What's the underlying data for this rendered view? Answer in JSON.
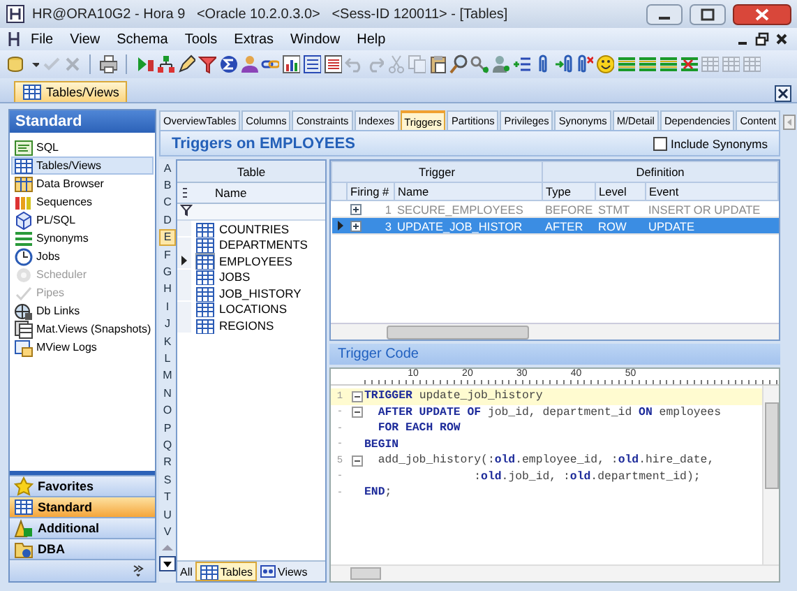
{
  "window": {
    "title": "HR@ORA10G2 - Hora 9   <Oracle 10.2.0.3.0>   <Sess-ID 120011> - [Tables]"
  },
  "menu": [
    "File",
    "View",
    "Schema",
    "Tools",
    "Extras",
    "Window",
    "Help"
  ],
  "toolbar": [
    {
      "kind": "db",
      "disabled": false
    },
    {
      "kind": "caret",
      "disabled": false
    },
    {
      "kind": "check",
      "disabled": true
    },
    {
      "kind": "cross",
      "disabled": true
    },
    {
      "kind": "separator"
    },
    {
      "kind": "printer",
      "disabled": false
    },
    {
      "kind": "separator"
    },
    {
      "kind": "play",
      "disabled": false
    },
    {
      "kind": "tree",
      "disabled": false
    },
    {
      "kind": "pen",
      "disabled": false
    },
    {
      "kind": "filter",
      "disabled": false
    },
    {
      "kind": "sigma",
      "disabled": false
    },
    {
      "kind": "person",
      "disabled": false
    },
    {
      "kind": "link",
      "disabled": false
    },
    {
      "kind": "chart",
      "disabled": false
    },
    {
      "kind": "form",
      "disabled": false
    },
    {
      "kind": "list",
      "disabled": false
    },
    {
      "kind": "undo",
      "disabled": true
    },
    {
      "kind": "redo",
      "disabled": true
    },
    {
      "kind": "cut",
      "disabled": true
    },
    {
      "kind": "copy",
      "disabled": true
    },
    {
      "kind": "paste",
      "disabled": false
    },
    {
      "kind": "search",
      "disabled": false
    },
    {
      "kind": "key",
      "disabled": false
    },
    {
      "kind": "findperson",
      "disabled": false
    },
    {
      "kind": "listadd",
      "disabled": false
    },
    {
      "kind": "clip",
      "disabled": false
    },
    {
      "kind": "clipin",
      "disabled": false
    },
    {
      "kind": "clipout",
      "disabled": false
    },
    {
      "kind": "smile",
      "disabled": false
    },
    {
      "kind": "bars",
      "disabled": false
    },
    {
      "kind": "bars",
      "disabled": false
    },
    {
      "kind": "bars",
      "disabled": false
    },
    {
      "kind": "barsx",
      "disabled": false
    },
    {
      "kind": "grid",
      "disabled": true
    },
    {
      "kind": "grid",
      "disabled": true
    },
    {
      "kind": "grid",
      "disabled": true
    }
  ],
  "document_tabs": [
    {
      "label": "Tables/Views",
      "selected": true
    }
  ],
  "navigator": {
    "title": "Standard",
    "items": [
      {
        "label": "SQL",
        "kind": "sql",
        "selected": false,
        "disabled": false
      },
      {
        "label": "Tables/Views",
        "kind": "table",
        "selected": true,
        "disabled": false
      },
      {
        "label": "Data Browser",
        "kind": "browser",
        "selected": false,
        "disabled": false
      },
      {
        "label": "Sequences",
        "kind": "sequence",
        "selected": false,
        "disabled": false
      },
      {
        "label": "PL/SQL",
        "kind": "plsql",
        "selected": false,
        "disabled": false
      },
      {
        "label": "Synonyms",
        "kind": "synonym",
        "selected": false,
        "disabled": false
      },
      {
        "label": "Jobs",
        "kind": "clock",
        "selected": false,
        "disabled": false
      },
      {
        "label": "Scheduler",
        "kind": "gear",
        "selected": false,
        "disabled": true
      },
      {
        "label": "Pipes",
        "kind": "pipe",
        "selected": false,
        "disabled": true
      },
      {
        "label": "Db Links",
        "kind": "link",
        "selected": false,
        "disabled": false
      },
      {
        "label": "Mat.Views (Snapshots)",
        "kind": "matview",
        "selected": false,
        "disabled": false
      },
      {
        "label": "MView Logs",
        "kind": "log",
        "selected": false,
        "disabled": false
      }
    ],
    "groups": [
      {
        "label": "Favorites",
        "kind": "star",
        "selected": false
      },
      {
        "label": "Standard",
        "kind": "table",
        "selected": true
      },
      {
        "label": "Additional",
        "kind": "shapes",
        "selected": false
      },
      {
        "label": "DBA",
        "kind": "dba",
        "selected": false
      }
    ]
  },
  "object_tabs": [
    {
      "label": "OverviewTables",
      "selected": false
    },
    {
      "label": "Columns",
      "selected": false
    },
    {
      "label": "Constraints",
      "selected": false
    },
    {
      "label": "Indexes",
      "selected": false
    },
    {
      "label": "Triggers",
      "selected": true
    },
    {
      "label": "Partitions",
      "selected": false
    },
    {
      "label": "Privileges",
      "selected": false
    },
    {
      "label": "Synonyms",
      "selected": false
    },
    {
      "label": "M/Detail",
      "selected": false
    },
    {
      "label": "Dependencies",
      "selected": false
    },
    {
      "label": "Content",
      "selected": false
    }
  ],
  "triggers_panel": {
    "title": "Triggers on EMPLOYEES",
    "include_synonyms": {
      "label": "Include Synonyms",
      "checked": false
    }
  },
  "index_letters": [
    {
      "label": "A",
      "selected": false
    },
    {
      "label": "B",
      "selected": false
    },
    {
      "label": "C",
      "selected": false
    },
    {
      "label": "D",
      "selected": false
    },
    {
      "label": "E",
      "selected": true
    },
    {
      "label": "F",
      "selected": false
    },
    {
      "label": "G",
      "selected": false
    },
    {
      "label": "H",
      "selected": false
    },
    {
      "label": "I",
      "selected": false
    },
    {
      "label": "J",
      "selected": false
    },
    {
      "label": "K",
      "selected": false
    },
    {
      "label": "L",
      "selected": false
    },
    {
      "label": "M",
      "selected": false
    },
    {
      "label": "N",
      "selected": false
    },
    {
      "label": "O",
      "selected": false
    },
    {
      "label": "P",
      "selected": false
    },
    {
      "label": "Q",
      "selected": false
    },
    {
      "label": "R",
      "selected": false
    },
    {
      "label": "S",
      "selected": false
    },
    {
      "label": "T",
      "selected": false
    },
    {
      "label": "U",
      "selected": false
    },
    {
      "label": "V",
      "selected": false
    }
  ],
  "table_list": {
    "band": "Table",
    "column": "Name",
    "rows": [
      {
        "name": "COUNTRIES",
        "selected": false
      },
      {
        "name": "DEPARTMENTS",
        "selected": false
      },
      {
        "name": "EMPLOYEES",
        "selected": true
      },
      {
        "name": "JOBS",
        "selected": false
      },
      {
        "name": "JOB_HISTORY",
        "selected": false
      },
      {
        "name": "LOCATIONS",
        "selected": false
      },
      {
        "name": "REGIONS",
        "selected": false
      }
    ],
    "filters": [
      {
        "label": "All",
        "kind": "all",
        "selected": false
      },
      {
        "label": "Tables",
        "kind": "tables",
        "selected": true
      },
      {
        "label": "Views",
        "kind": "views",
        "selected": false
      }
    ]
  },
  "trigger_grid": {
    "bands": [
      "Trigger",
      "Definition"
    ],
    "columns": [
      "Firing #",
      "Name",
      "Type",
      "Level",
      "Event"
    ],
    "rows": [
      {
        "firing": "1",
        "name": "SECURE_EMPLOYEES",
        "type": "BEFORE",
        "level": "STMT",
        "event": "INSERT OR UPDATE",
        "selected": false,
        "disabled": true
      },
      {
        "firing": "3",
        "name": "UPDATE_JOB_HISTOR",
        "type": "AFTER",
        "level": "ROW",
        "event": "UPDATE",
        "selected": true,
        "disabled": false
      }
    ]
  },
  "code_panel": {
    "title": "Trigger Code",
    "ruler": [
      "10",
      "20",
      "30",
      "40",
      "50"
    ],
    "lines": [
      {
        "number": "1",
        "text": "**TRIGGER** update_job_history",
        "current": true,
        "fold": true
      },
      {
        "number": "-",
        "text": "  **AFTER UPDATE OF** job_id, department_id **ON** employees",
        "current": false,
        "fold": true
      },
      {
        "number": "-",
        "text": "  **FOR EACH ROW**",
        "current": false,
        "fold": false
      },
      {
        "number": "-",
        "text": "**BEGIN**",
        "current": false,
        "fold": false
      },
      {
        "number": "5",
        "text": "  add_job_history(:**old**.employee_id, :**old**.hire_date,",
        "current": false,
        "fold": true
      },
      {
        "number": "-",
        "text": "                :**old**.job_id, :**old**.department_id);",
        "current": false,
        "fold": false
      },
      {
        "number": "-",
        "text": "**END**;",
        "current": false,
        "fold": false
      }
    ]
  }
}
